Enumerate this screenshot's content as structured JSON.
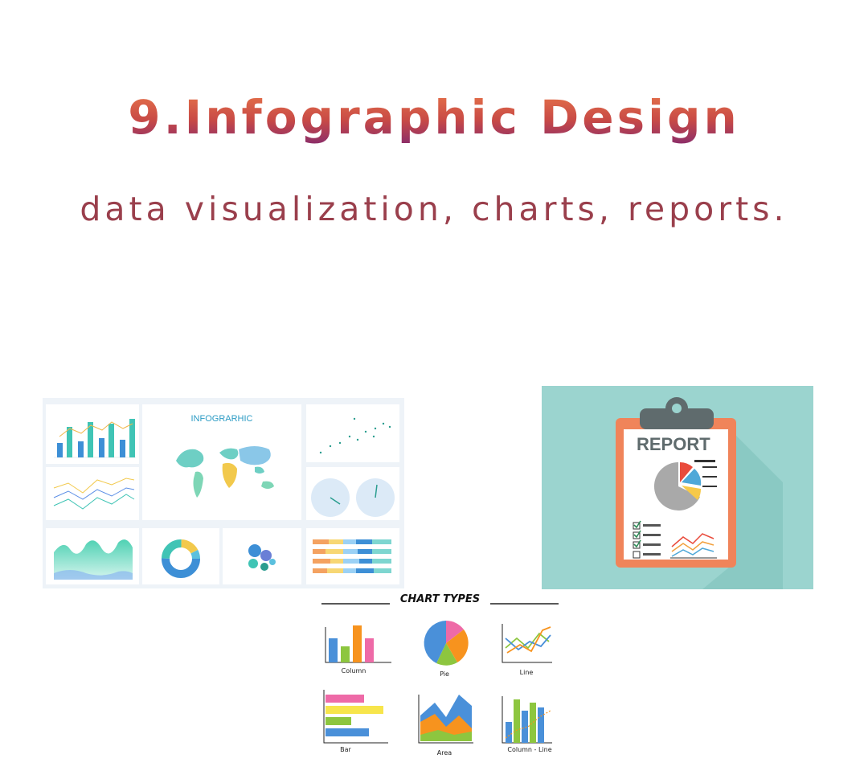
{
  "header": {
    "title": "9.Infographic Design",
    "subtitle": "data visualization, charts, reports."
  },
  "dashboard": {
    "map_title": "INFOGRARHIC"
  },
  "report_card": {
    "title": "REPORT"
  },
  "chart_types": {
    "heading": "CHART TYPES",
    "items": [
      {
        "label": "Column",
        "icon": "column-chart-icon"
      },
      {
        "label": "Pie",
        "icon": "pie-chart-icon"
      },
      {
        "label": "Line",
        "icon": "line-chart-icon"
      },
      {
        "label": "Bar",
        "icon": "bar-chart-icon"
      },
      {
        "label": "Area",
        "icon": "area-chart-icon"
      },
      {
        "label": "Column - Line",
        "icon": "column-line-chart-icon"
      }
    ]
  },
  "colors": {
    "title_gradient": [
      "#e8764a",
      "#c84a46",
      "#8a2d6a"
    ],
    "subtitle": "#9a3f4c",
    "report_background": "#9bd4cf",
    "clipboard": "#f0845a"
  }
}
